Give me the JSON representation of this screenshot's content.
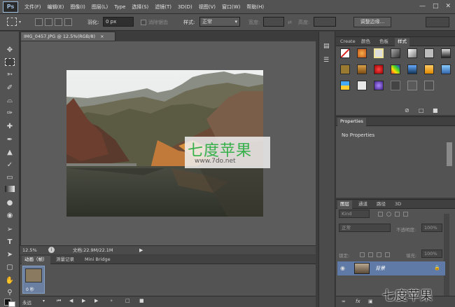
{
  "menu": {
    "logo": "Ps",
    "items": [
      "文件(F)",
      "编辑(E)",
      "图像(I)",
      "图层(L)",
      "Type",
      "选择(S)",
      "滤镜(T)",
      "3D(D)",
      "视图(V)",
      "窗口(W)",
      "帮助(H)"
    ]
  },
  "options": {
    "feather_label": "羽化:",
    "feather_value": "0 px",
    "antialias_label": "消除锯齿",
    "style_label": "样式:",
    "style_value": "正常",
    "width_label": "宽度:",
    "height_label": "高度:",
    "refine_button": "调整边缘..."
  },
  "document": {
    "tab_title": "IMG_0457.JPG @ 12.5%(RGB/8)",
    "zoom": "12.5%",
    "doc_info": "文档:22.9M/22.1M"
  },
  "bottom_panel": {
    "tabs": [
      "动画（帧）",
      "测量记录",
      "Mini Bridge"
    ],
    "frame_time": "0 秒",
    "loop": "永远"
  },
  "styles_panel": {
    "tabs": [
      "Create",
      "颜色",
      "色板",
      "样式"
    ]
  },
  "properties_panel": {
    "title": "Properties",
    "content": "No Properties"
  },
  "layers_panel": {
    "tabs": [
      "图层",
      "通道",
      "路径",
      "3D"
    ],
    "filter": "Kind",
    "blend_mode": "正常",
    "opacity_label": "不透明度:",
    "opacity_value": "100%",
    "lock_label": "锁定:",
    "fill_label": "填充:",
    "fill_value": "100%",
    "layer_name": "背景"
  },
  "watermark": {
    "text": "七度苹果",
    "url": "www.7do.net",
    "corner": "七度苹果"
  },
  "colors": {
    "bg_dark": "#3c3c3c",
    "panel": "#535353",
    "canvas": "#5c5c5c",
    "selected_layer": "#5f7aa6",
    "watermark_green": "#36b04a"
  }
}
